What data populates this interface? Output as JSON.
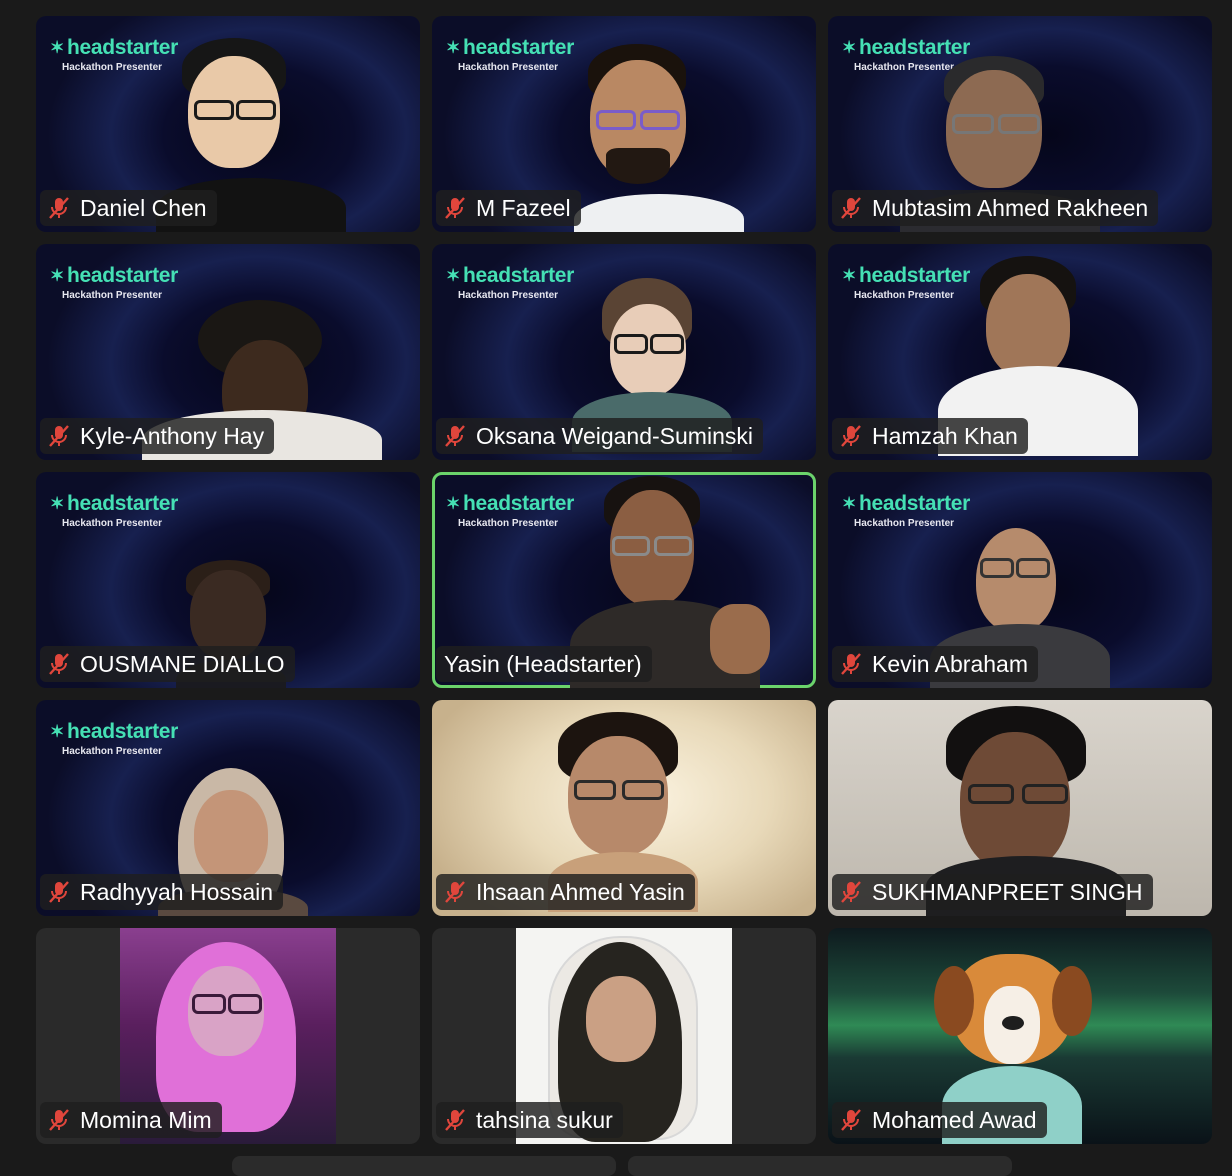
{
  "brand": {
    "logo_text": "headstarter",
    "subtitle": "Hackathon Presenter",
    "accent": "#45e0b4"
  },
  "participants": [
    {
      "name": "Daniel Chen",
      "muted": true,
      "bg": "branded"
    },
    {
      "name": "M Fazeel",
      "muted": true,
      "bg": "branded"
    },
    {
      "name": "Mubtasim Ahmed Rakheen",
      "muted": true,
      "bg": "branded"
    },
    {
      "name": "Kyle-Anthony Hay",
      "muted": true,
      "bg": "branded"
    },
    {
      "name": "Oksana Weigand-Suminski",
      "muted": true,
      "bg": "branded"
    },
    {
      "name": "Hamzah Khan",
      "muted": true,
      "bg": "branded"
    },
    {
      "name": "OUSMANE DIALLO",
      "muted": true,
      "bg": "branded"
    },
    {
      "name": "Yasin (Headstarter)",
      "muted": false,
      "bg": "branded",
      "active_speaker": true
    },
    {
      "name": "Kevin Abraham",
      "muted": true,
      "bg": "branded"
    },
    {
      "name": "Radhyyah Hossain",
      "muted": true,
      "bg": "branded"
    },
    {
      "name": "Ihsaan Ahmed Yasin",
      "muted": true,
      "bg": "warm"
    },
    {
      "name": "SUKHMANPREET SINGH",
      "muted": true,
      "bg": "grey"
    },
    {
      "name": "Momina Mim",
      "muted": true,
      "bg": "photo"
    },
    {
      "name": "tahsina sukur",
      "muted": true,
      "bg": "photo"
    },
    {
      "name": "Mohamed Awad",
      "muted": true,
      "bg": "aurora"
    }
  ],
  "colors": {
    "active_border": "#6bd36b",
    "muted_icon": "#e0463c"
  }
}
